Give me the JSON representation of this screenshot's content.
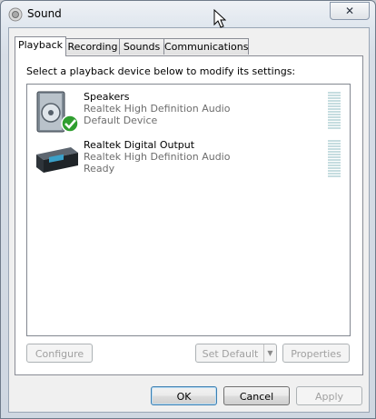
{
  "window": {
    "title": "Sound",
    "close_label": "✕"
  },
  "tabs": [
    {
      "label": "Playback",
      "active": true
    },
    {
      "label": "Recording",
      "active": false
    },
    {
      "label": "Sounds",
      "active": false
    },
    {
      "label": "Communications",
      "active": false
    }
  ],
  "playback": {
    "instruction": "Select a playback device below to modify its settings:",
    "devices": [
      {
        "name": "Speakers",
        "description": "Realtek High Definition Audio",
        "status": "Default Device",
        "icon": "speaker-icon",
        "is_default": true
      },
      {
        "name": "Realtek Digital Output",
        "description": "Realtek High Definition Audio",
        "status": "Ready",
        "icon": "digital-output-icon",
        "is_default": false
      }
    ],
    "buttons": {
      "configure": "Configure",
      "set_default": "Set Default",
      "properties": "Properties"
    }
  },
  "dialog_buttons": {
    "ok": "OK",
    "cancel": "Cancel",
    "apply": "Apply"
  },
  "colors": {
    "accent": "#3c7fb1",
    "meter": "#c6dde0",
    "check": "#2f9e2f"
  }
}
